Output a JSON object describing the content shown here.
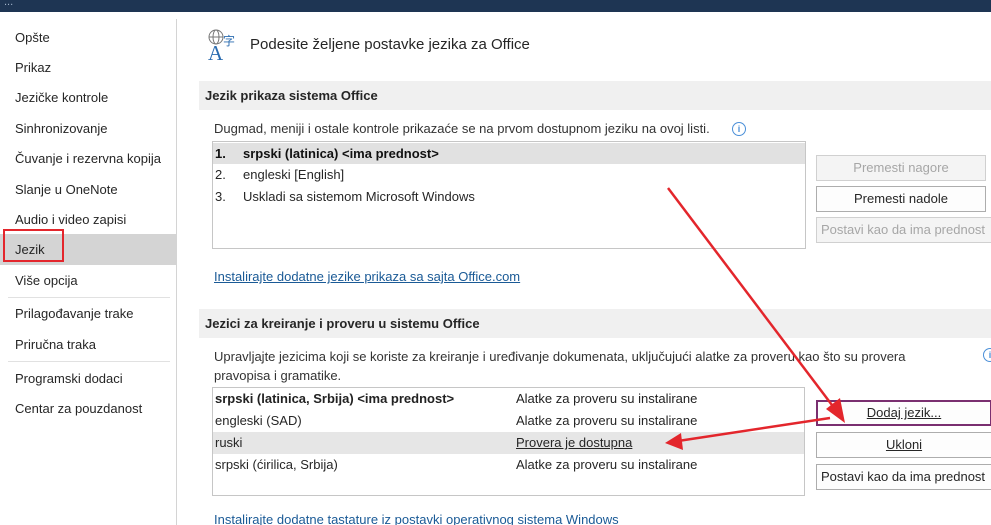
{
  "window": {
    "title_fragment": "..."
  },
  "nav": {
    "items": [
      "Opšte",
      "Prikaz",
      "Jezičke kontrole",
      "Sinhronizovanje",
      "Čuvanje i rezervna kopija",
      "Slanje u OneNote",
      "Audio i video zapisi",
      "Jezik",
      "Više opcija",
      "Prilagođavanje trake",
      "Priručna traka",
      "Programski dodaci",
      "Centar za pouzdanost"
    ],
    "selected": "Jezik"
  },
  "main": {
    "title": "Podesite željene postavke jezika za Office",
    "icon": "language-icon"
  },
  "display_section": {
    "heading": "Jezik prikaza sistema Office",
    "description": "Dugmad, meniji i ostale kontrole prikazaće se na prvom dostupnom jeziku na ovoj listi.",
    "languages": [
      {
        "num": "1.",
        "label": "srpski (latinica) <ima prednost>",
        "selected": true
      },
      {
        "num": "2.",
        "label": "engleski [English]",
        "selected": false
      },
      {
        "num": "3.",
        "label": "Uskladi sa sistemom Microsoft Windows",
        "selected": false
      }
    ],
    "buttons": {
      "move_up": "Premesti nagore",
      "move_down": "Premesti nadole",
      "set_preferred": "Postavi kao da ima prednost"
    },
    "link": "Instalirajte dodatne jezike prikaza sa sajta Office.com"
  },
  "authoring_section": {
    "heading": "Jezici za kreiranje i proveru u sistemu Office",
    "description_line1": "Upravljajte jezicima koji se koriste za kreiranje i uređivanje dokumenata, uključujući alatke za proveru kao što su provera",
    "description_line2": "pravopisa i gramatike.",
    "languages": [
      {
        "name": "srpski (latinica, Srbija) <ima prednost>",
        "status": "Alatke za proveru su instalirane",
        "bold": true,
        "selected": false
      },
      {
        "name": "engleski (SAD)",
        "status": "Alatke za proveru su instalirane",
        "bold": false,
        "selected": false
      },
      {
        "name": "ruski",
        "status": "Provera je dostupna",
        "bold": false,
        "selected": true
      },
      {
        "name": "srpski (ćirilica, Srbija)",
        "status": "Alatke za proveru su instalirane",
        "bold": false,
        "selected": false
      }
    ],
    "buttons": {
      "add": "Dodaj jezik...",
      "remove": "Ukloni",
      "set_preferred": "Postavi kao da ima prednost"
    },
    "link": "Instalirajte dodatne tastature iz postavki operativnog sistema Windows"
  },
  "colors": {
    "highlight_red": "#e3262c",
    "selection_gray": "#d4d4d4",
    "link_blue": "#1a5a96",
    "focus_purple": "#7a2f70",
    "title_bar": "#1e3553"
  }
}
